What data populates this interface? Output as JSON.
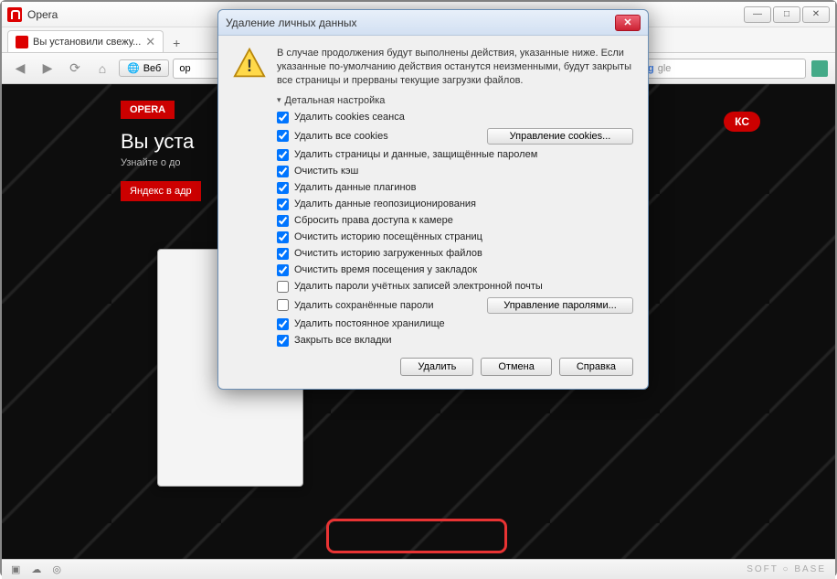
{
  "app": {
    "title": "Opera"
  },
  "window_controls": {
    "min": "—",
    "max": "□",
    "close": "✕"
  },
  "tab": {
    "title": "Вы установили свежу...",
    "close": "✕",
    "new": "+"
  },
  "toolbar": {
    "web_label": "Веб",
    "address_value": "op",
    "search_placeholder": "gle"
  },
  "hero": {
    "logo": "OPERA",
    "heading": "Вы уста",
    "sub": "Узнайте о до",
    "yandex_btn": "Яндекс в адр",
    "russian_tag": "КС"
  },
  "status": {
    "watermark": "SOFT ○ BASE"
  },
  "dialog": {
    "title": "Удаление личных данных",
    "info": "В случае продолжения будут выполнены действия, указанные ниже. Если указанные по-умолчанию действия останутся неизменными, будут закрыты все страницы и прерваны текущие загрузки файлов.",
    "detail_toggle": "Детальная настройка",
    "manage_cookies": "Управление cookies...",
    "manage_passwords": "Управление паролями...",
    "options": [
      {
        "label": "Удалить cookies сеанса",
        "checked": true
      },
      {
        "label": "Удалить все cookies",
        "checked": true,
        "manage": "cookies"
      },
      {
        "label": "Удалить страницы и данные, защищённые паролем",
        "checked": true
      },
      {
        "label": "Очистить кэш",
        "checked": true
      },
      {
        "label": "Удалить данные плагинов",
        "checked": true
      },
      {
        "label": "Удалить данные геопозиционирования",
        "checked": true
      },
      {
        "label": "Сбросить права доступа к камере",
        "checked": true
      },
      {
        "label": "Очистить историю посещённых страниц",
        "checked": true
      },
      {
        "label": "Очистить историю загруженных файлов",
        "checked": true
      },
      {
        "label": "Очистить время посещения у закладок",
        "checked": true
      },
      {
        "label": "Удалить пароли учётных записей электронной почты",
        "checked": false
      },
      {
        "label": "Удалить сохранённые пароли",
        "checked": false,
        "manage": "passwords"
      },
      {
        "label": "Удалить постоянное хранилище",
        "checked": true
      },
      {
        "label": "Закрыть все вкладки",
        "checked": true
      }
    ],
    "buttons": {
      "delete": "Удалить",
      "cancel": "Отмена",
      "help": "Справка"
    }
  }
}
